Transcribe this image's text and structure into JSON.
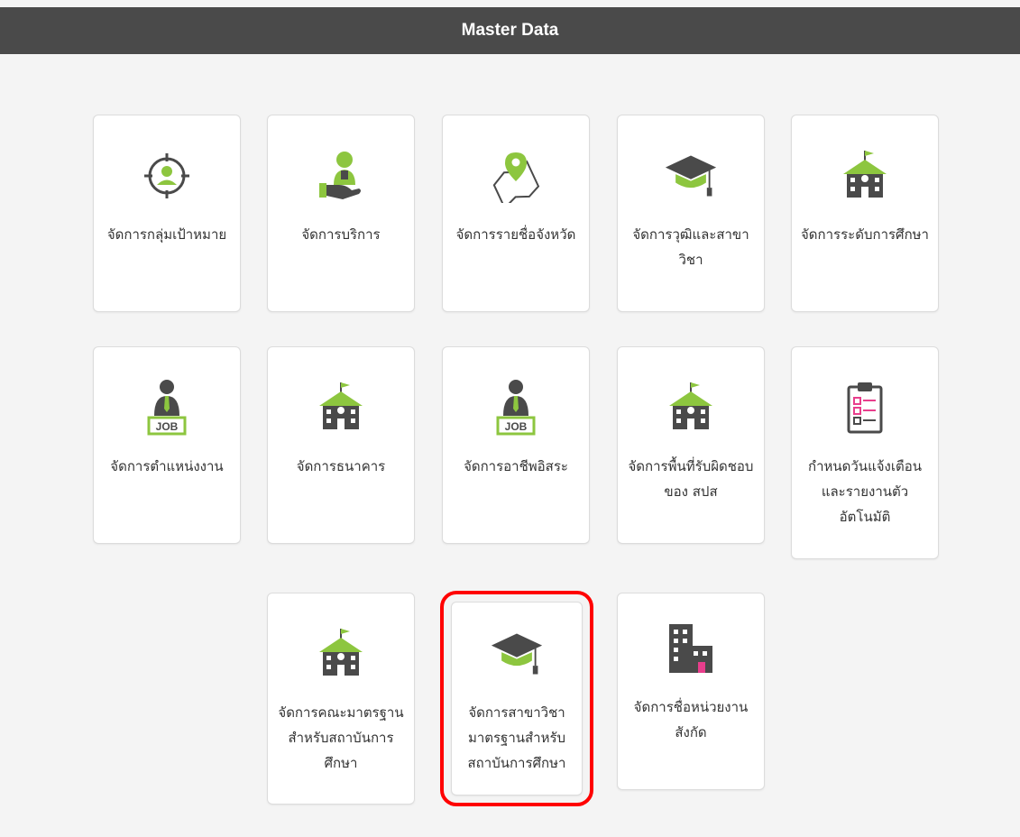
{
  "header": {
    "title": "Master Data"
  },
  "colors": {
    "accent": "#8dc63f",
    "dark_icon": "#4a4a4a",
    "highlight": "#ff0000",
    "pink_accent": "#e83e8c"
  },
  "tiles": [
    {
      "label": "จัดการกลุ่มเป้าหมาย",
      "icon": "target-user-icon"
    },
    {
      "label": "จัดการบริการ",
      "icon": "service-person-icon"
    },
    {
      "label": "จัดการรายชื่อจังหวัด",
      "icon": "map-pin-icon"
    },
    {
      "label": "จัดการวุฒิและสาขาวิชา",
      "icon": "graduation-cap-icon"
    },
    {
      "label": "จัดการระดับการศึกษา",
      "icon": "school-building-icon"
    },
    {
      "label": "จัดการตำแหน่งงาน",
      "icon": "job-person-icon"
    },
    {
      "label": "จัดการธนาคาร",
      "icon": "school-building-icon"
    },
    {
      "label": "จัดการอาชีพอิสระ",
      "icon": "job-person-icon"
    },
    {
      "label": "จัดการพื้นที่รับผิดชอบของ สปส",
      "icon": "school-building-icon"
    },
    {
      "label": "กำหนดวันแจ้งเตือนและรายงานตัวอัตโนมัติ",
      "icon": "checklist-clipboard-icon"
    },
    {
      "label": "จัดการคณะมาตรฐานสำหรับสถาบันการศึกษา",
      "icon": "school-building-icon"
    },
    {
      "label": "จัดการสาขาวิชามาตรฐานสำหรับสถาบันการศึกษา",
      "icon": "graduation-cap-icon",
      "highlighted": true
    },
    {
      "label": "จัดการชื่อหน่วยงานสังกัด",
      "icon": "office-building-icon"
    }
  ]
}
